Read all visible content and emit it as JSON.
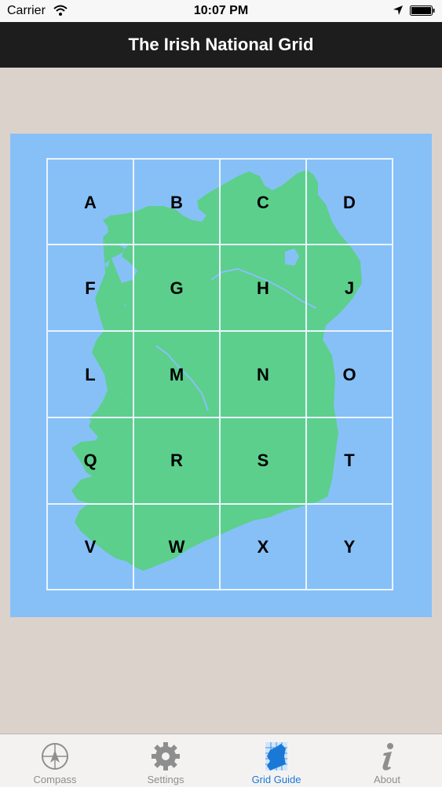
{
  "status_bar": {
    "carrier": "Carrier",
    "time": "10:07 PM"
  },
  "nav": {
    "title": "The Irish National Grid"
  },
  "grid": {
    "rows": [
      [
        "A",
        "B",
        "C",
        "D"
      ],
      [
        "F",
        "G",
        "H",
        "J"
      ],
      [
        "L",
        "M",
        "N",
        "O"
      ],
      [
        "Q",
        "R",
        "S",
        "T"
      ],
      [
        "V",
        "W",
        "X",
        "Y"
      ]
    ]
  },
  "tabs": [
    {
      "label": "Compass",
      "icon": "compass-icon"
    },
    {
      "label": "Settings",
      "icon": "gear-icon"
    },
    {
      "label": "Grid Guide",
      "icon": "ireland-grid-icon",
      "active": true
    },
    {
      "label": "About",
      "icon": "info-icon"
    }
  ],
  "colors": {
    "sea": "#87c0f7",
    "land": "#5ccf8c",
    "grid_lines": "#e9f4ff",
    "active_tab": "#1a79d6",
    "nav_background": "#1d1d1d"
  }
}
